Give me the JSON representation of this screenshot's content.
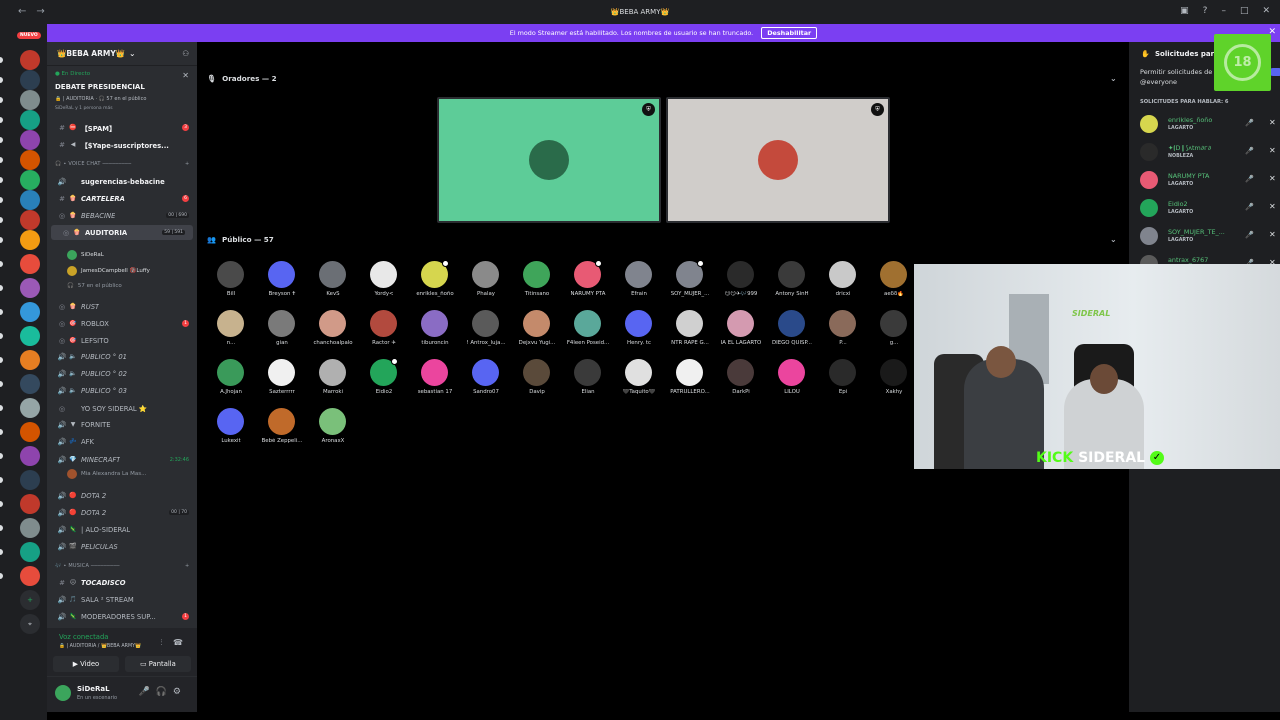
{
  "window": {
    "title": "👑BEBA ARMY👑",
    "nav_back": "←",
    "nav_forward": "→"
  },
  "banner": {
    "text": "El modo Streamer está habilitado. Los nombres de usuario se han truncado.",
    "button": "Deshabilitar"
  },
  "rail": {
    "new_badge": "NUEVO"
  },
  "server": {
    "name": "👑BEBA ARMY👑"
  },
  "event": {
    "live_label": "● En Directo",
    "title": "DEBATE PRESIDENCIAL",
    "meta": "🔒 | AUDITORIA · 🎧 57 en el público",
    "meta2": "SiDeRaL y 1 persona más"
  },
  "channels": [
    {
      "glyph": "#",
      "emoji": "⛔",
      "name": "【SPAM】",
      "style": "bold",
      "red": "3"
    },
    {
      "glyph": "#",
      "emoji": "◀",
      "name": "【$Yape-suscriptores...",
      "style": "bold"
    },
    {
      "glyph": "🔊",
      "emoji": "",
      "name": "sugerencias-bebacine",
      "style": "bold"
    },
    {
      "glyph": "#",
      "emoji": "🍿",
      "name": "CARTELERA",
      "style": "bold italic",
      "red": "6"
    },
    {
      "glyph": "◎",
      "emoji": "🍿",
      "name": "BEBACINE",
      "style": "italic",
      "cnt": "00 | 690"
    },
    {
      "glyph": "◎",
      "emoji": "🍿",
      "name": "AUDITORIA",
      "style": "bold active",
      "cnt": "59 | 591"
    },
    {
      "glyph": "◎",
      "emoji": "🍿",
      "name": "RUST",
      "style": "italic"
    },
    {
      "glyph": "◎",
      "emoji": "🎯",
      "name": "ROBLOX",
      "style": "",
      "red": "1"
    },
    {
      "glyph": "◎",
      "emoji": "🎯",
      "name": "LEFSITO",
      "style": ""
    },
    {
      "glyph": "🔊",
      "emoji": "🔈",
      "name": "PUBLICO ° 01",
      "style": "italic"
    },
    {
      "glyph": "🔊",
      "emoji": "🔈",
      "name": "PUBLICO ° 02",
      "style": "italic"
    },
    {
      "glyph": "🔊",
      "emoji": "🔈",
      "name": "PUBLICO ° 03",
      "style": "italic"
    },
    {
      "glyph": "◎",
      "emoji": "",
      "name": "YO SOY SIDERAL ⭐",
      "style": ""
    },
    {
      "glyph": "🔊",
      "emoji": "▼",
      "name": "FORNITE",
      "style": ""
    },
    {
      "glyph": "🔊",
      "emoji": "💤",
      "name": "AFK",
      "style": ""
    },
    {
      "glyph": "🔊",
      "emoji": "💎",
      "name": "MINECRAFT",
      "style": "italic",
      "time": "2:32:46"
    },
    {
      "glyph": "🔊",
      "emoji": "🔴",
      "name": "DOTA 2",
      "style": "italic"
    },
    {
      "glyph": "🔊",
      "emoji": "🔴",
      "name": "DOTA 2",
      "style": "italic",
      "cnt": "00 | 70"
    },
    {
      "glyph": "🔊",
      "emoji": "🦎",
      "name": "| ALO-SIDERAL",
      "style": ""
    },
    {
      "glyph": "🔊",
      "emoji": "🎬",
      "name": "PELICULAS",
      "style": "italic"
    },
    {
      "glyph": "#",
      "emoji": "😐",
      "name": "TOCADISCO",
      "style": "bold italic"
    },
    {
      "glyph": "🔊",
      "emoji": "🎵",
      "name": "SALA ² STREAM",
      "style": ""
    },
    {
      "glyph": "🔊",
      "emoji": "🦎",
      "name": "MODERADORES SUP...",
      "style": "",
      "red": "1"
    }
  ],
  "categories": {
    "voice_chat": "🎧 ∙ VOICE CHAT ─────────",
    "musica": "🎶 ∙ MUSICA ─────────"
  },
  "auditoria_members": [
    {
      "name": "SiDeRaL"
    },
    {
      "name": "JamesDCampbell 🔞Luffy"
    }
  ],
  "auditoria_public": "57 en el público",
  "minecraft_member": "Mia Alexandra La Mas...",
  "voice": {
    "status": "Voz conectada",
    "sub": "🔒 | AUDITORIA / 👑BEBA ARMY👑",
    "video": "Video",
    "screen": "Pantalla"
  },
  "user": {
    "name": "SiDeRaL",
    "status": "En un escenario"
  },
  "stage": {
    "speakers_header": "Oradores — 2",
    "audience_header": "Público — 57",
    "speakers": [
      {
        "bg": "#5dcc98",
        "avatar": "#2a6b4a"
      },
      {
        "bg": "#d0cdca",
        "avatar": "#c44a3c"
      }
    ],
    "audience": [
      {
        "name": "Bill",
        "color": "#4a4a4a"
      },
      {
        "name": "Breyson 🕇",
        "color": "#5865f2"
      },
      {
        "name": "KevS",
        "color": "#6b6f75"
      },
      {
        "name": "Yordy<",
        "color": "#e8e8e8"
      },
      {
        "name": "enrikles_ñoño",
        "color": "#d6d64e",
        "dot": true
      },
      {
        "name": "Phalay",
        "color": "#8a8a8a"
      },
      {
        "name": "Titinsano",
        "color": "#3fa55a"
      },
      {
        "name": "NARUMY PTA",
        "color": "#e85a74",
        "dot": true
      },
      {
        "name": "Efrain",
        "color": "#80848e"
      },
      {
        "name": "SOY_MUJER_...",
        "color": "#80848e",
        "dot": true
      },
      {
        "name": "😏😏✈🎶999",
        "color": "#2a2a2a"
      },
      {
        "name": "Antony SinH",
        "color": "#3a3a3a"
      },
      {
        "name": "dricxi",
        "color": "#c9c9c9"
      },
      {
        "name": "aeδδ🔥",
        "color": "#a07030"
      },
      {
        "name": "n...",
        "color": "#c7b28e"
      },
      {
        "name": "gian",
        "color": "#7a7a7a"
      },
      {
        "name": "chanchoalpalo",
        "color": "#d19a88"
      },
      {
        "name": "Ractor ✈",
        "color": "#b24a3e"
      },
      {
        "name": "tiburoncin",
        "color": "#8a6cc4"
      },
      {
        "name": "! Antrox_luja...",
        "color": "#5a5a5a"
      },
      {
        "name": "Dejxvu Yugi...",
        "color": "#c48a6b"
      },
      {
        "name": "F4leen Poseid...",
        "color": "#5aa89a"
      },
      {
        "name": "Henry. tc",
        "color": "#5865f2"
      },
      {
        "name": "NTR RAPE G...",
        "color": "#d0d0d0"
      },
      {
        "name": "IA EL LAGARTO",
        "color": "#d49ab0"
      },
      {
        "name": "DIEGO QUISP...",
        "color": "#2a4a8a"
      },
      {
        "name": "P...",
        "color": "#8a6a5a"
      },
      {
        "name": "g...",
        "color": "#3a3a3a"
      },
      {
        "name": "A.Jhojan",
        "color": "#3a9a5a"
      },
      {
        "name": "Sazterrrrr",
        "color": "#f0f0f0"
      },
      {
        "name": "Marroki",
        "color": "#b0b0b0"
      },
      {
        "name": "Eidio2",
        "color": "#23a55a",
        "dot": true
      },
      {
        "name": "sebastian 17",
        "color": "#eb459e"
      },
      {
        "name": "Sandro07",
        "color": "#5865f2"
      },
      {
        "name": "Davip",
        "color": "#5a4a3a"
      },
      {
        "name": "Elian",
        "color": "#3a3a3a"
      },
      {
        "name": "🖤Taquito🖤",
        "color": "#e0e0e0"
      },
      {
        "name": "PATRULLERO...",
        "color": "#f0f0f0"
      },
      {
        "name": "DarkPi",
        "color": "#4a3a3a"
      },
      {
        "name": "LILOU",
        "color": "#eb459e"
      },
      {
        "name": "Epi",
        "color": "#2a2a2a"
      },
      {
        "name": "Xakhy",
        "color": "#1a1a1a"
      },
      {
        "name": "Lukexit",
        "color": "#5865f2"
      },
      {
        "name": "Bebé Zeppeli...",
        "color": "#c06a2a"
      },
      {
        "name": "AronaxX",
        "color": "#7ac07a"
      }
    ]
  },
  "webcam": {
    "neon": "SIDERAL",
    "logo_kick": "KICK",
    "logo_name": "SIDERAL",
    "check": "✓"
  },
  "right_panel": {
    "header": "Solicitudes para",
    "permission": "Permitir solicitudes de @everyone",
    "requests_header": "SOLICITUDES PARA HABLAR: 6",
    "requests": [
      {
        "name": "enrikles_ñoño",
        "role": "LAGARTO",
        "color": "#d6d64e"
      },
      {
        "name": "✦⦗D❙⟆ᴧtm∂ᴦ∂",
        "role": "NOBLEZA",
        "color": "#2a2a2a"
      },
      {
        "name": "NARUMY PTA",
        "role": "LAGARTO",
        "color": "#e85a74"
      },
      {
        "name": "Eidio2",
        "role": "LAGARTO",
        "color": "#23a55a"
      },
      {
        "name": "SOY_MUJER_TE_...",
        "role": "LAGARTO",
        "color": "#80848e"
      },
      {
        "name": "antrax_6767",
        "role": "",
        "color": "#5a5a5a"
      }
    ]
  },
  "age_badge": "18"
}
